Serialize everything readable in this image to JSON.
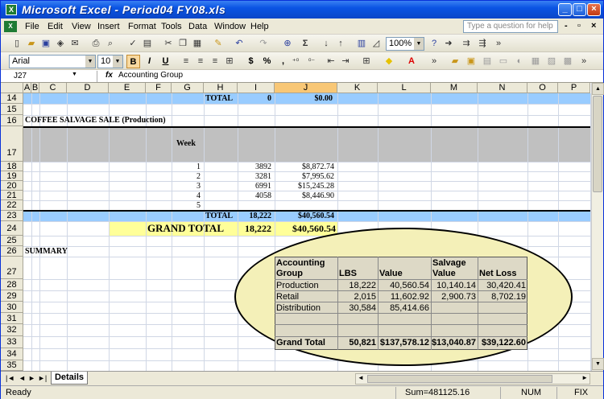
{
  "window": {
    "title": "Microsoft Excel - Period04 FY08.xls"
  },
  "menu": {
    "items": [
      "File",
      "Edit",
      "View",
      "Insert",
      "Format",
      "Tools",
      "Data",
      "Window",
      "Help"
    ],
    "question_placeholder": "Type a question for help"
  },
  "toolbar": {
    "zoom": "100%",
    "sigma": "Σ"
  },
  "format_toolbar": {
    "font": "Arial",
    "size": "10",
    "bold": "B",
    "italic": "I",
    "underline": "U",
    "currency": "$",
    "percent": "%",
    "comma": ","
  },
  "formula_bar": {
    "name_box": "J27",
    "fx": "fx",
    "value": "Accounting Group"
  },
  "columns": [
    "A",
    "B",
    "C",
    "D",
    "E",
    "F",
    "G",
    "H",
    "I",
    "J",
    "K",
    "L",
    "M",
    "N",
    "O",
    "P"
  ],
  "rows": [
    "14",
    "15",
    "16",
    "17",
    "18",
    "19",
    "20",
    "21",
    "22",
    "23",
    "24",
    "25",
    "26",
    "27",
    "28",
    "29",
    "30",
    "31",
    "32",
    "33",
    "34",
    "35"
  ],
  "sheet": {
    "r14": {
      "label": "TOTAL",
      "lbs": "0",
      "value": "$0.00"
    },
    "r16": {
      "title": "COFFEE SALVAGE SALE (Production)"
    },
    "r17": {
      "week_header": "Week"
    },
    "weeks": [
      {
        "week": "1",
        "lbs": "3892",
        "value": "$8,872.74"
      },
      {
        "week": "2",
        "lbs": "3281",
        "value": "$7,995.62"
      },
      {
        "week": "3",
        "lbs": "6991",
        "value": "$15,245.28"
      },
      {
        "week": "4",
        "lbs": "4058",
        "value": "$8,446.90"
      },
      {
        "week": "5",
        "lbs": "",
        "value": ""
      }
    ],
    "r23": {
      "label": "TOTAL",
      "lbs": "18,222",
      "value": "$40,560.54"
    },
    "r24": {
      "label": "GRAND TOTAL",
      "lbs": "18,222",
      "value": "$40,560.54"
    },
    "r26": {
      "label": "SUMMARY"
    },
    "summary": {
      "headers": {
        "group_line1": "Accounting",
        "group_line2": "Group",
        "lbs": "LBS",
        "value": "Value",
        "salvage_line1": "Salvage",
        "salvage_line2": "Value",
        "netloss": "Net Loss"
      },
      "rows": [
        {
          "group": "Production",
          "lbs": "18,222",
          "value": "40,560.54",
          "salvage": "10,140.14",
          "netloss": "30,420.41"
        },
        {
          "group": "Retail",
          "lbs": "2,015",
          "value": "11,602.92",
          "salvage": "2,900.73",
          "netloss": "8,702.19"
        },
        {
          "group": "Distribution",
          "lbs": "30,584",
          "value": "85,414.66",
          "salvage": "",
          "netloss": ""
        }
      ],
      "total": {
        "group": "Grand Total",
        "lbs": "50,821",
        "value": "$137,578.12",
        "salvage": "$13,040.87",
        "netloss": "$39,122.60"
      }
    }
  },
  "tabs": {
    "active": "Details"
  },
  "status": {
    "ready": "Ready",
    "sum": "Sum=481125.16",
    "num": "NUM",
    "fix": "FIX"
  },
  "colors": {
    "blue_band": "#99ccff",
    "yellow_band": "#ffff99",
    "gray_fill": "#c0c0c0",
    "selected_header": "#f8c776"
  }
}
